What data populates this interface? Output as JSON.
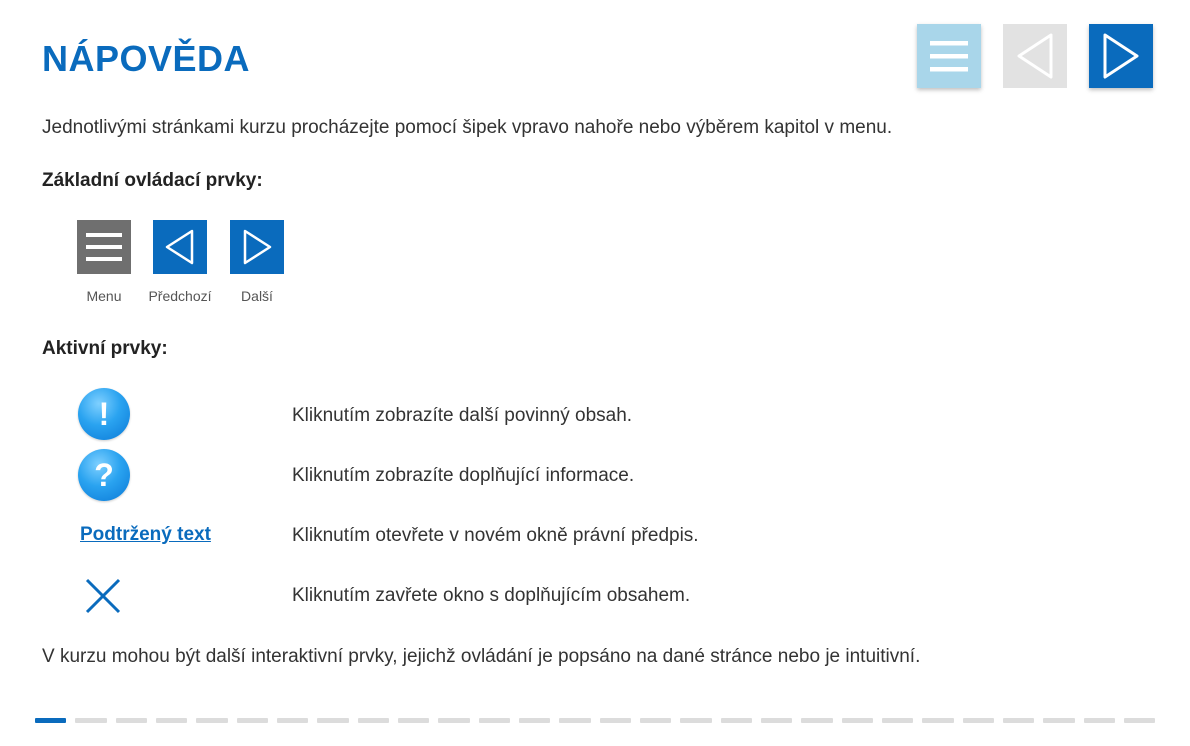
{
  "header": {
    "title": "NÁPOVĚDA",
    "nav_buttons": [
      {
        "name": "menu",
        "icon": "hamburger-icon",
        "color": "#a9d6ea"
      },
      {
        "name": "previous",
        "icon": "triangle-left-icon",
        "color": "#e2e2e2",
        "state": "disabled"
      },
      {
        "name": "next",
        "icon": "triangle-right-icon",
        "color": "#0a6bbd"
      }
    ]
  },
  "intro": "Jednotlivými stránkami kurzu procházejte pomocí šipek vpravo nahoře nebo výběrem kapitol v menu.",
  "basic_controls": {
    "heading": "Základní ovládací prvky:",
    "items": [
      {
        "label": "Menu",
        "icon": "hamburger-icon",
        "color": "#6f6f6f"
      },
      {
        "label": "Předchozí",
        "icon": "triangle-left-icon",
        "color": "#0a6bbd"
      },
      {
        "label": "Další",
        "icon": "triangle-right-icon",
        "color": "#0a6bbd"
      }
    ]
  },
  "active_elements": {
    "heading": "Aktivní prvky:",
    "items": [
      {
        "icon": "exclamation-icon",
        "symbol": "!",
        "description": "Kliknutím zobrazíte další povinný obsah."
      },
      {
        "icon": "question-icon",
        "symbol": "?",
        "description": "Kliknutím zobrazíte doplňující informace."
      },
      {
        "link_text": "Podtržený text",
        "description": "Kliknutím otevřete v novém okně právní předpis."
      },
      {
        "icon": "close-icon",
        "description": "Kliknutím zavřete okno s doplňujícím obsahem."
      }
    ]
  },
  "outro": "V kurzu mohou být další interaktivní prvky, jejichž ovládání je popsáno na dané stránce nebo je intuitivní.",
  "progress": {
    "total_pages": 28,
    "current_page": 1
  },
  "colors": {
    "accent": "#0a6bbd",
    "text": "#333333"
  }
}
